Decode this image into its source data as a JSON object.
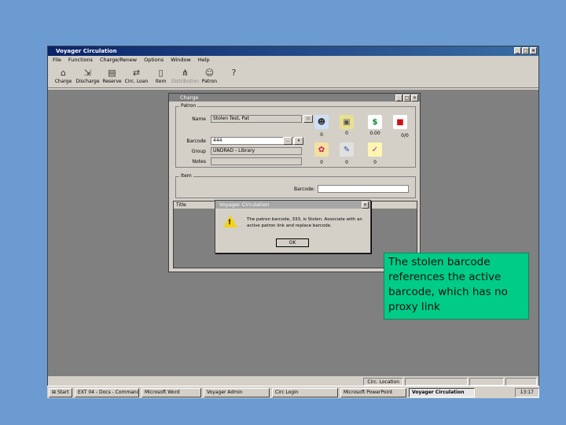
{
  "app": {
    "title": "Voyager Circulation",
    "menu": [
      "File",
      "Functions",
      "Charge/Renew",
      "Options",
      "Window",
      "Help"
    ],
    "toolbar": [
      {
        "label": "Charge",
        "icon": "charge-icon"
      },
      {
        "label": "Discharge",
        "icon": "discharge-icon"
      },
      {
        "label": "Reserve",
        "icon": "reserve-icon"
      },
      {
        "label": "Circ. Loan",
        "icon": "circ-loan-icon"
      },
      {
        "label": "Item",
        "icon": "item-icon"
      },
      {
        "label": "Distribution",
        "icon": "distribution-icon"
      },
      {
        "label": "Patron",
        "icon": "patron-icon"
      },
      {
        "label": "",
        "icon": "help-pointer-icon"
      }
    ],
    "status": [
      "Circ. Location",
      "",
      "",
      ""
    ]
  },
  "charge_window": {
    "title": "Charge",
    "patron_group": "Patron",
    "name_label": "Name",
    "name_value": "Stolen Test, Pat",
    "barcode_label": "Barcode",
    "barcode_value": "444",
    "group_label": "Group",
    "group_value": "UNDRAD - Library",
    "notes_label": "Notes",
    "item_group": "Item",
    "item_barcode_label": "Barcode:",
    "title_col": "Title",
    "counts_row1": [
      "0",
      "0",
      "0.00",
      "0/0"
    ],
    "counts_row2": [
      "0",
      "0",
      "0",
      "0"
    ]
  },
  "dialog": {
    "title": "Voyager Circulation",
    "message": "The patron barcode, 333, is Stolen. Associate with an active patron link and replace barcode.",
    "ok_label": "OK"
  },
  "callout": {
    "text": "The stolen barcode references the active barcode, which has no proxy link"
  },
  "taskbar": {
    "start_label": "Start",
    "tasks": [
      "EXT 04 - Docs - Command",
      "Microsoft Word",
      "Voyager Admin",
      "Circ Login",
      "Microsoft PowerPoint",
      "Voyager Circulation"
    ],
    "clock": "13:17"
  },
  "colors": {
    "desktop": "#6b9bd1",
    "callout": "#00cc88",
    "workspace": "#808080"
  }
}
